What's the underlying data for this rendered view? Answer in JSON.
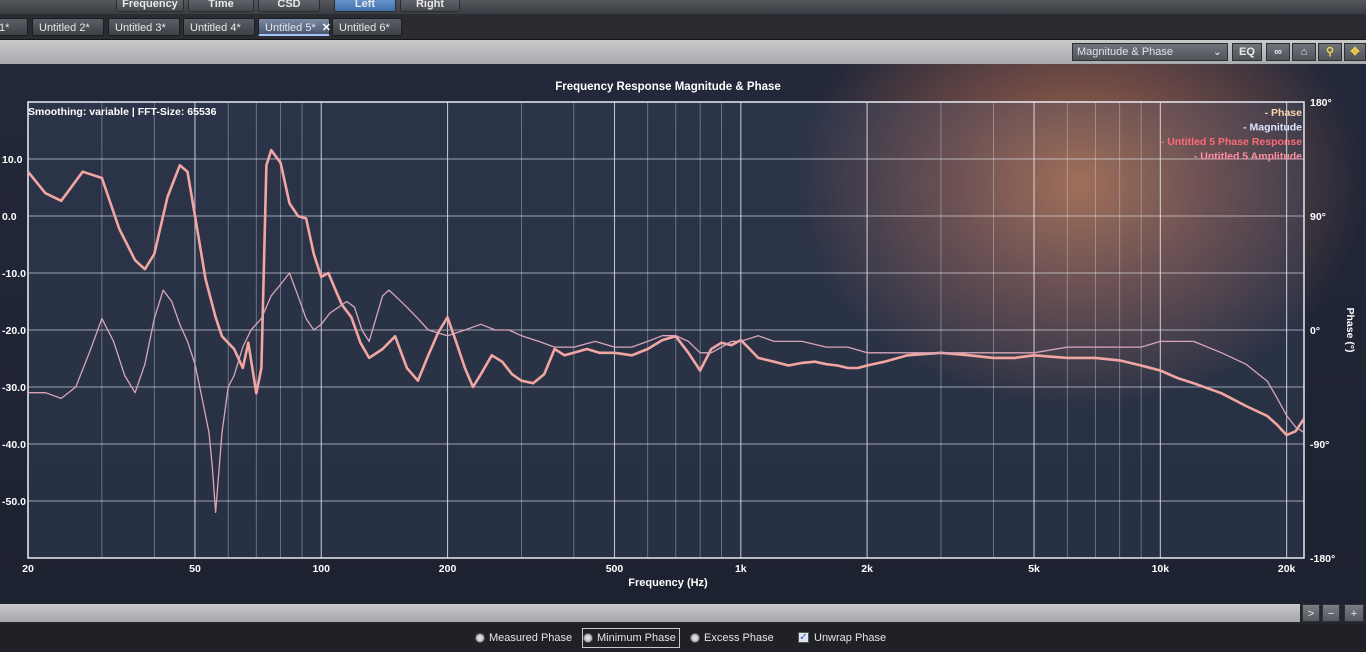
{
  "topbar": {
    "buttons": [
      "Frequency",
      "Time",
      "CSD",
      "Left",
      "Right"
    ]
  },
  "tabs": [
    {
      "label": "1*"
    },
    {
      "label": "Untitled 2*"
    },
    {
      "label": "Untitled 3*"
    },
    {
      "label": "Untitled 4*"
    },
    {
      "label": "Untitled 5*",
      "close": "✕"
    },
    {
      "label": "Untitled 6*"
    }
  ],
  "viewbar": {
    "view_select": "Magnitude & Phase",
    "eq_label": "EQ",
    "link_icon": "∞",
    "home_icon": "⌂",
    "zoom_icon": "🔍",
    "move_icon": "✥"
  },
  "chart_data": {
    "type": "line",
    "title": "Frequency Response Magnitude & Phase",
    "info": "Smoothing: variable | FFT-Size: 65536",
    "xlabel": "Frequency (Hz)",
    "ylabel_right": "Phase (°)",
    "xscale": "log",
    "xlim": [
      20,
      22000
    ],
    "ylim_left": [
      -60,
      20
    ],
    "ylim_right": [
      -180,
      180
    ],
    "x_tick_labels": [
      {
        "v": 20,
        "t": "20"
      },
      {
        "v": 50,
        "t": "50"
      },
      {
        "v": 100,
        "t": "100"
      },
      {
        "v": 200,
        "t": "200"
      },
      {
        "v": 500,
        "t": "500"
      },
      {
        "v": 1000,
        "t": "1k"
      },
      {
        "v": 2000,
        "t": "2k"
      },
      {
        "v": 5000,
        "t": "5k"
      },
      {
        "v": 10000,
        "t": "10k"
      },
      {
        "v": 20000,
        "t": "20k"
      }
    ],
    "y_left_ticks": [
      {
        "v": 10,
        "t": "10.0"
      },
      {
        "v": 0,
        "t": "0.0"
      },
      {
        "v": -10,
        "t": "-10.0"
      },
      {
        "v": -20,
        "t": "-20.0"
      },
      {
        "v": -30,
        "t": "-30.0"
      },
      {
        "v": -40,
        "t": "-40.0"
      },
      {
        "v": -50,
        "t": "-50.0"
      }
    ],
    "y_right_ticks": [
      {
        "v": 180,
        "t": "180°"
      },
      {
        "v": 90,
        "t": "90°"
      },
      {
        "v": 0,
        "t": "0°"
      },
      {
        "v": -90,
        "t": "-90°"
      },
      {
        "v": -180,
        "t": "-180°"
      }
    ],
    "legend": [
      {
        "text": "- Phase",
        "color": "#ffd6a8"
      },
      {
        "text": "- Magnitude",
        "color": "#dce6ff"
      },
      {
        "text": "- Untitled 5 Phase Response",
        "color": "#ff6a78"
      },
      {
        "text": "- Untitled 5 Amplitude",
        "color": "#ff8fa0"
      }
    ],
    "grid": true,
    "legend_position": "top-right",
    "series": [
      {
        "name": "Untitled 5 Phase Response",
        "axis": "phase",
        "color": "#f2a6a2",
        "points": [
          [
            20,
            125
          ],
          [
            22,
            108
          ],
          [
            24,
            102
          ],
          [
            27,
            125
          ],
          [
            30,
            120
          ],
          [
            33,
            80
          ],
          [
            36,
            55
          ],
          [
            38,
            48
          ],
          [
            40,
            60
          ],
          [
            43,
            105
          ],
          [
            46,
            130
          ],
          [
            48,
            125
          ],
          [
            50,
            90
          ],
          [
            53,
            40
          ],
          [
            56,
            10
          ],
          [
            58,
            -5
          ],
          [
            62,
            -15
          ],
          [
            65,
            -30
          ],
          [
            67,
            -10
          ],
          [
            70,
            -50
          ],
          [
            72,
            -30
          ],
          [
            74,
            130
          ],
          [
            76,
            142
          ],
          [
            80,
            132
          ],
          [
            84,
            100
          ],
          [
            88,
            90
          ],
          [
            92,
            88
          ],
          [
            96,
            60
          ],
          [
            100,
            42
          ],
          [
            104,
            45
          ],
          [
            108,
            32
          ],
          [
            112,
            20
          ],
          [
            118,
            10
          ],
          [
            124,
            -10
          ],
          [
            130,
            -22
          ],
          [
            140,
            -15
          ],
          [
            150,
            -5
          ],
          [
            160,
            -30
          ],
          [
            170,
            -40
          ],
          [
            180,
            -20
          ],
          [
            190,
            -2
          ],
          [
            200,
            10
          ],
          [
            210,
            -10
          ],
          [
            220,
            -30
          ],
          [
            230,
            -45
          ],
          [
            240,
            -35
          ],
          [
            255,
            -20
          ],
          [
            270,
            -25
          ],
          [
            285,
            -35
          ],
          [
            300,
            -40
          ],
          [
            320,
            -42
          ],
          [
            340,
            -35
          ],
          [
            360,
            -15
          ],
          [
            380,
            -20
          ],
          [
            400,
            -18
          ],
          [
            430,
            -15
          ],
          [
            460,
            -18
          ],
          [
            500,
            -18
          ],
          [
            550,
            -20
          ],
          [
            600,
            -15
          ],
          [
            650,
            -8
          ],
          [
            700,
            -5
          ],
          [
            750,
            -18
          ],
          [
            800,
            -32
          ],
          [
            850,
            -15
          ],
          [
            900,
            -10
          ],
          [
            950,
            -12
          ],
          [
            1000,
            -8
          ],
          [
            1050,
            -15
          ],
          [
            1100,
            -22
          ],
          [
            1200,
            -25
          ],
          [
            1300,
            -28
          ],
          [
            1400,
            -26
          ],
          [
            1500,
            -25
          ],
          [
            1600,
            -27
          ],
          [
            1700,
            -28
          ],
          [
            1800,
            -30
          ],
          [
            1900,
            -30
          ],
          [
            2000,
            -28
          ],
          [
            2200,
            -25
          ],
          [
            2500,
            -20
          ],
          [
            3000,
            -18
          ],
          [
            3500,
            -20
          ],
          [
            4000,
            -22
          ],
          [
            4500,
            -22
          ],
          [
            5000,
            -20
          ],
          [
            6000,
            -22
          ],
          [
            7000,
            -22
          ],
          [
            8000,
            -24
          ],
          [
            9000,
            -28
          ],
          [
            10000,
            -32
          ],
          [
            11000,
            -38
          ],
          [
            12000,
            -42
          ],
          [
            14000,
            -50
          ],
          [
            16000,
            -60
          ],
          [
            18000,
            -68
          ],
          [
            19000,
            -75
          ],
          [
            20000,
            -83
          ],
          [
            21000,
            -80
          ],
          [
            22000,
            -70
          ]
        ]
      },
      {
        "name": "Untitled 5 Amplitude",
        "axis": "magnitude",
        "color": "#d9a6b8",
        "points": [
          [
            20,
            -31
          ],
          [
            22,
            -31
          ],
          [
            24,
            -32
          ],
          [
            26,
            -30
          ],
          [
            28,
            -24
          ],
          [
            30,
            -18
          ],
          [
            32,
            -22
          ],
          [
            34,
            -28
          ],
          [
            36,
            -31
          ],
          [
            38,
            -26
          ],
          [
            40,
            -18
          ],
          [
            42,
            -13
          ],
          [
            44,
            -15
          ],
          [
            46,
            -19
          ],
          [
            48,
            -22
          ],
          [
            50,
            -26
          ],
          [
            52,
            -32
          ],
          [
            54,
            -38
          ],
          [
            55,
            -44
          ],
          [
            56,
            -52
          ],
          [
            57,
            -45
          ],
          [
            58,
            -38
          ],
          [
            60,
            -30
          ],
          [
            62,
            -28
          ],
          [
            65,
            -23
          ],
          [
            68,
            -20
          ],
          [
            72,
            -18
          ],
          [
            76,
            -14
          ],
          [
            80,
            -12
          ],
          [
            84,
            -10
          ],
          [
            88,
            -14
          ],
          [
            92,
            -18
          ],
          [
            96,
            -20
          ],
          [
            100,
            -19
          ],
          [
            105,
            -17
          ],
          [
            110,
            -16
          ],
          [
            115,
            -15
          ],
          [
            120,
            -16
          ],
          [
            125,
            -20
          ],
          [
            130,
            -22
          ],
          [
            135,
            -18
          ],
          [
            140,
            -14
          ],
          [
            145,
            -13
          ],
          [
            150,
            -14
          ],
          [
            160,
            -16
          ],
          [
            170,
            -18
          ],
          [
            180,
            -20
          ],
          [
            200,
            -21
          ],
          [
            220,
            -20
          ],
          [
            240,
            -19
          ],
          [
            260,
            -20
          ],
          [
            280,
            -20
          ],
          [
            300,
            -21
          ],
          [
            330,
            -22
          ],
          [
            360,
            -23
          ],
          [
            400,
            -23
          ],
          [
            450,
            -22
          ],
          [
            500,
            -23
          ],
          [
            550,
            -23
          ],
          [
            600,
            -22
          ],
          [
            650,
            -21
          ],
          [
            700,
            -21
          ],
          [
            750,
            -22
          ],
          [
            800,
            -24
          ],
          [
            850,
            -24
          ],
          [
            900,
            -23
          ],
          [
            950,
            -22
          ],
          [
            1000,
            -22
          ],
          [
            1100,
            -21
          ],
          [
            1200,
            -22
          ],
          [
            1400,
            -22
          ],
          [
            1600,
            -23
          ],
          [
            1800,
            -23
          ],
          [
            2000,
            -24
          ],
          [
            2500,
            -24
          ],
          [
            3000,
            -24
          ],
          [
            4000,
            -24
          ],
          [
            5000,
            -24
          ],
          [
            6000,
            -23
          ],
          [
            7000,
            -23
          ],
          [
            8000,
            -23
          ],
          [
            9000,
            -23
          ],
          [
            10000,
            -22
          ],
          [
            11000,
            -22
          ],
          [
            12000,
            -22
          ],
          [
            14000,
            -24
          ],
          [
            16000,
            -26
          ],
          [
            18000,
            -29
          ],
          [
            19000,
            -32
          ],
          [
            20000,
            -35
          ],
          [
            21000,
            -37
          ],
          [
            22000,
            -38
          ]
        ]
      }
    ]
  },
  "bottom": {
    "options": [
      {
        "label": "Measured Phase",
        "kind": "radio",
        "selected": false
      },
      {
        "label": "Minimum Phase",
        "kind": "radio",
        "selected": true
      },
      {
        "label": "Excess Phase",
        "kind": "radio",
        "selected": false
      },
      {
        "label": "Unwrap Phase",
        "kind": "checkbox",
        "checked": true
      }
    ],
    "scroll_right": ">",
    "zoom_out": "−",
    "zoom_in": "+"
  }
}
